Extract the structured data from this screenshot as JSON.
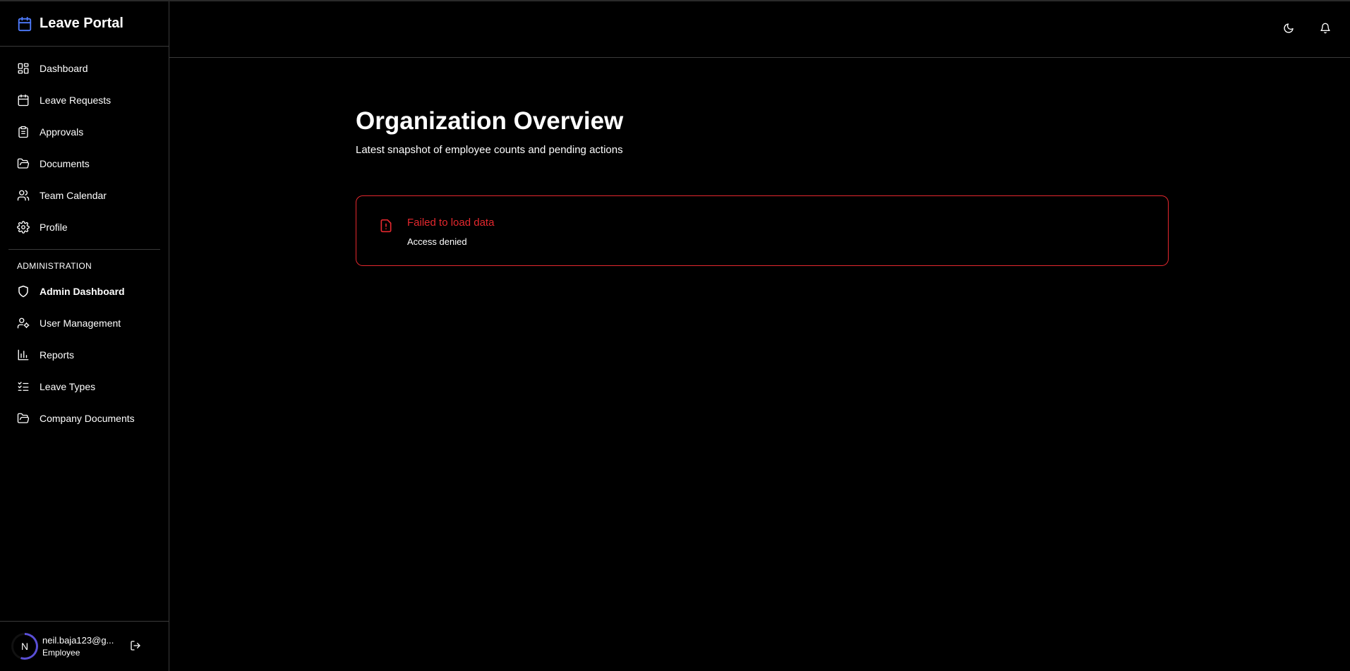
{
  "brand": {
    "title": "Leave Portal",
    "accent": "#4f7cff"
  },
  "nav": {
    "items": [
      {
        "label": "Dashboard",
        "icon": "dashboard-icon"
      },
      {
        "label": "Leave Requests",
        "icon": "calendar-icon"
      },
      {
        "label": "Approvals",
        "icon": "clipboard-icon"
      },
      {
        "label": "Documents",
        "icon": "folder-open-icon"
      },
      {
        "label": "Team Calendar",
        "icon": "users-icon"
      },
      {
        "label": "Profile",
        "icon": "gear-icon"
      }
    ],
    "admin_section_label": "ADMINISTRATION",
    "admin_items": [
      {
        "label": "Admin Dashboard",
        "icon": "shield-icon",
        "active": true
      },
      {
        "label": "User Management",
        "icon": "user-cog-icon"
      },
      {
        "label": "Reports",
        "icon": "bar-chart-icon"
      },
      {
        "label": "Leave Types",
        "icon": "list-checks-icon"
      },
      {
        "label": "Company Documents",
        "icon": "folder-open-icon"
      }
    ]
  },
  "user": {
    "initial": "N",
    "email": "neil.baja123@g...",
    "role": "Employee"
  },
  "header": {
    "theme_icon": "moon-icon",
    "notifications_icon": "bell-icon"
  },
  "main": {
    "title": "Organization Overview",
    "subtitle": "Latest snapshot of employee counts and pending actions",
    "alert": {
      "title": "Failed to load data",
      "description": "Access denied",
      "color": "#e5282e"
    }
  }
}
